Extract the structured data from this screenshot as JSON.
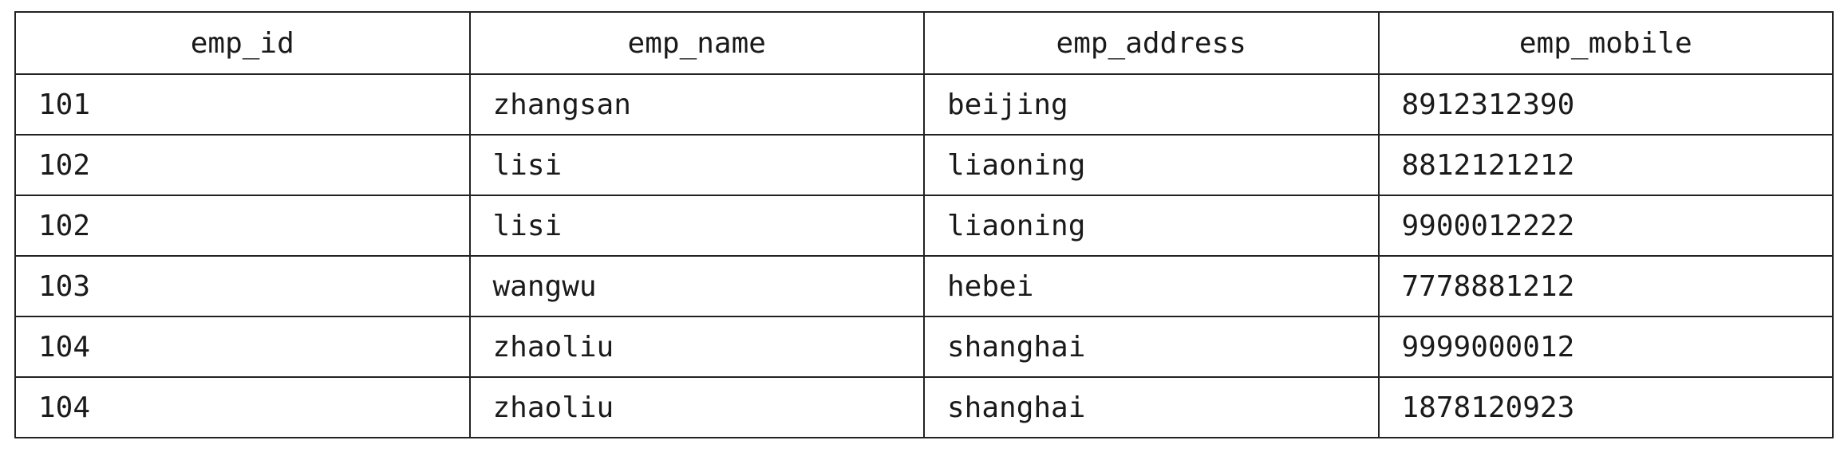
{
  "table": {
    "columns": [
      "emp_id",
      "emp_name",
      "emp_address",
      "emp_mobile"
    ],
    "rows": [
      [
        "101",
        "zhangsan",
        "beijing",
        "8912312390"
      ],
      [
        "102",
        "lisi",
        "liaoning",
        "8812121212"
      ],
      [
        "102",
        "lisi",
        "liaoning",
        "9900012222"
      ],
      [
        "103",
        "wangwu",
        "hebei",
        "7778881212"
      ],
      [
        "104",
        "zhaoliu",
        "shanghai",
        "9999000012"
      ],
      [
        "104",
        "zhaoliu",
        "shanghai",
        "1878120923"
      ]
    ]
  }
}
